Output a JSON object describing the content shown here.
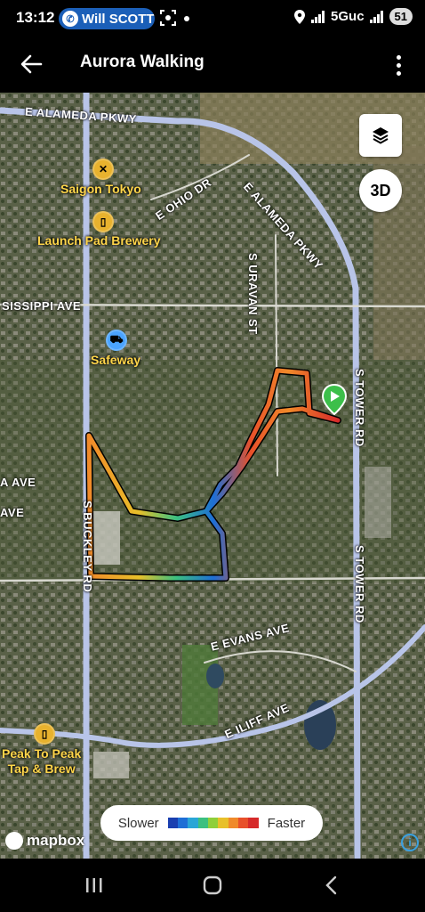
{
  "status_bar": {
    "time": "13:12",
    "call_name": "Will SCOTT",
    "network": "5Guc",
    "battery": "51"
  },
  "app_bar": {
    "title": "Aurora Walking"
  },
  "map": {
    "streets": {
      "alameda_west": "E ALAMEDA PKWY",
      "alameda_east": "E ALAMEDA PKWY",
      "ohio": "E OHIO DR",
      "uravan": "S URAVAN ST",
      "mississippi": "SISSIPPI AVE",
      "tower_north": "S TOWER RD",
      "tower_south": "S TOWER RD",
      "buckley": "S BUCKLEY RD",
      "evans": "E EVANS AVE",
      "iliff": "E ILIFF AVE",
      "left_ave_1": "A AVE",
      "left_ave_2": "AVE"
    },
    "pois": {
      "saigon": "Saigon Tokyo",
      "launchpad": "Launch Pad Brewery",
      "safeway": "Safeway",
      "peak_line1": "Peak To Peak",
      "peak_line2": "Tap & Brew"
    },
    "icons": [
      "fork-knife-icon",
      "beer-icon",
      "cart-icon",
      "layers-icon",
      "start-flag-icon"
    ]
  },
  "controls": {
    "three_d": "3D"
  },
  "legend": {
    "slower": "Slower",
    "faster": "Faster",
    "colors": [
      "#1a3fb0",
      "#1e6fd6",
      "#2aa6d6",
      "#3cc080",
      "#8fcf3a",
      "#e8c02a",
      "#f08a2a",
      "#e8502a",
      "#d62a2a"
    ]
  },
  "attribution": {
    "mapbox": "mapbox"
  }
}
